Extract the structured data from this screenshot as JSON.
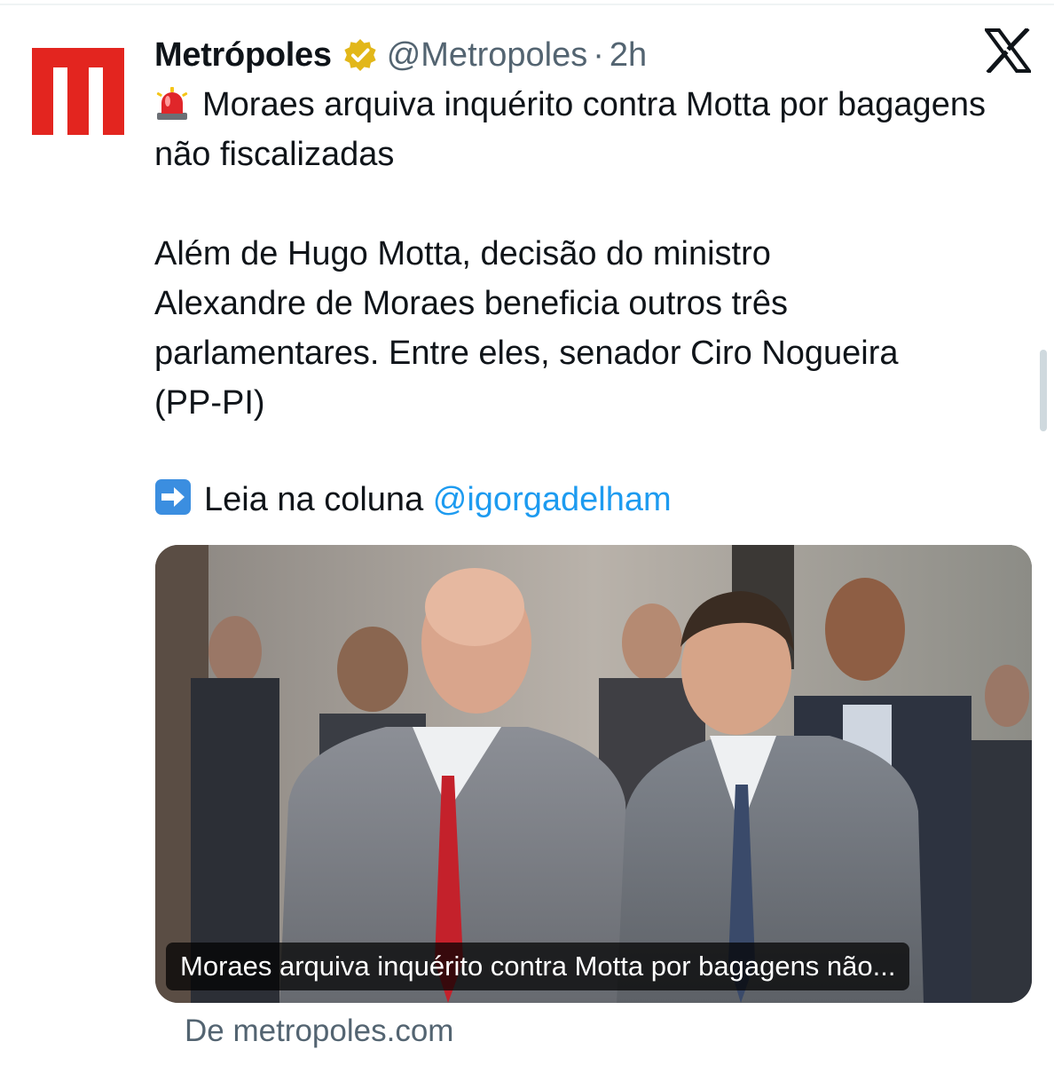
{
  "tweet": {
    "author_name": "Metrópoles",
    "handle": "@Metropoles",
    "separator": "·",
    "time": "2h",
    "verified": true,
    "headline": "Moraes arquiva inquérito contra Motta por bagagens não fiscalizadas",
    "body_lines": [
      "Além de Hugo Motta, decisão do ministro",
      "Alexandre de Moraes beneficia outros três",
      "parlamentares. Entre eles, senador Ciro Nogueira",
      "(PP-PI)"
    ],
    "link_prefix": "Leia na coluna",
    "mention": "@igorgadelham"
  },
  "card": {
    "caption": "Moraes arquiva inquérito contra Motta por bagagens não...",
    "source": "De metropoles.com"
  },
  "icons": {
    "avatar": "metropoles-m-logo",
    "badge": "gold-verified-badge",
    "siren": "rotating-light-emoji",
    "arrow": "right-arrow-emoji",
    "platform": "x-logo"
  },
  "colors": {
    "brand_red": "#e3251f",
    "verified_gold": "#e2b719",
    "link_blue": "#1d9bf0",
    "secondary_text": "#536471",
    "arrow_emoji_blue": "#3b8ee0"
  }
}
